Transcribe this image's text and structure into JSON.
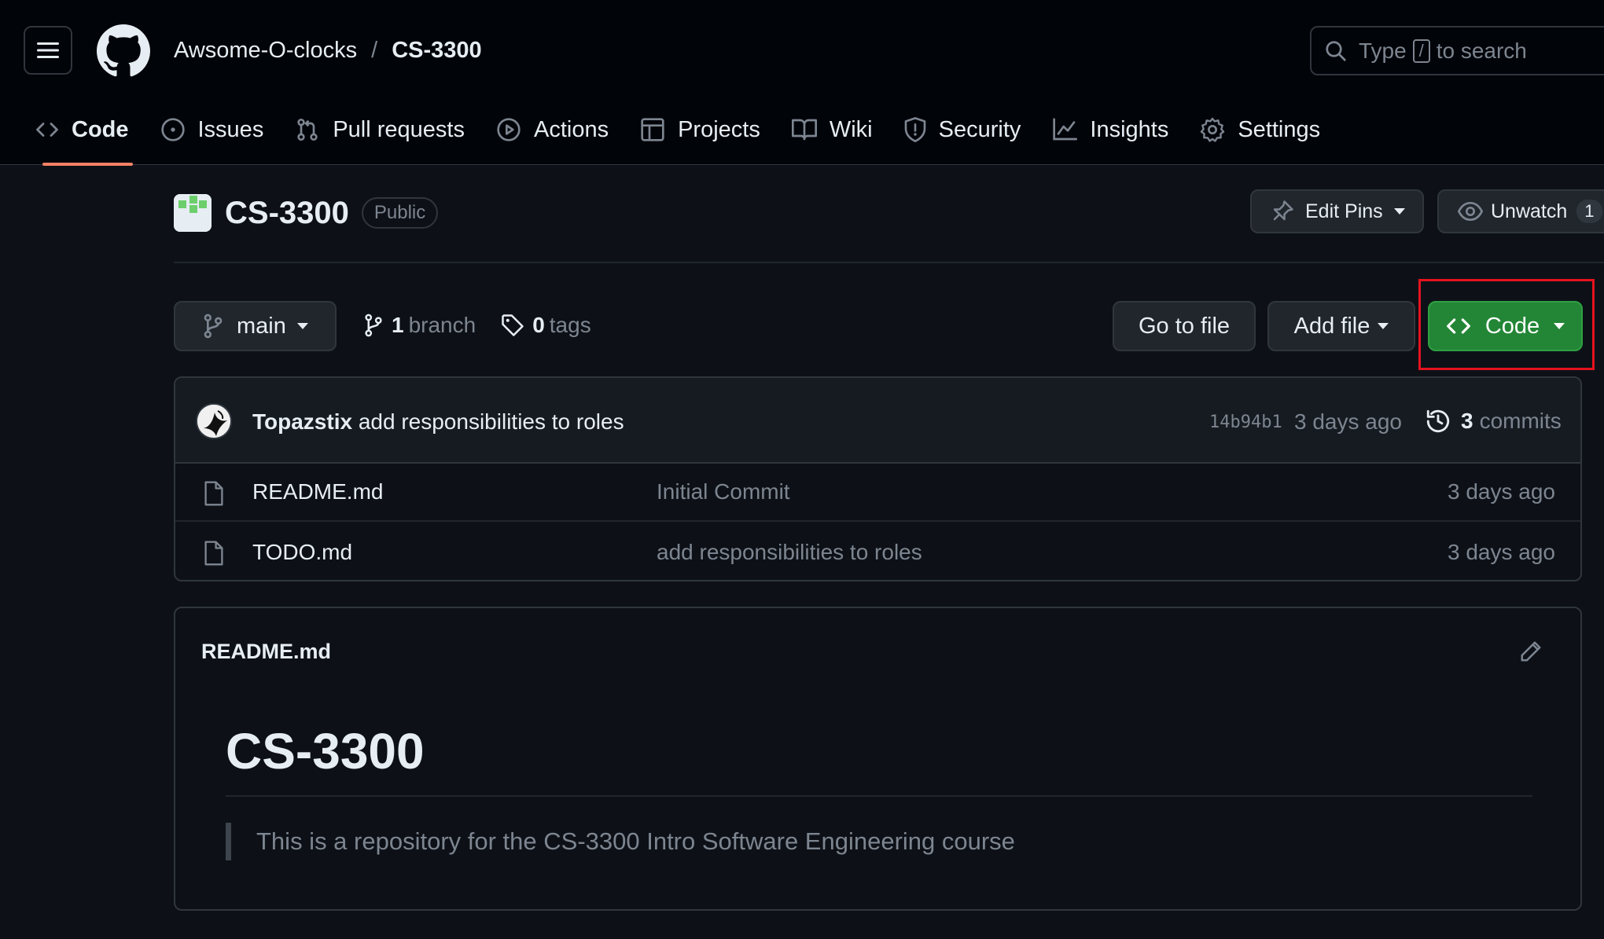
{
  "header": {
    "owner": "Awsome-O-clocks",
    "separator": "/",
    "repo": "CS-3300",
    "search": {
      "prefix": "Type",
      "key": "/",
      "suffix": "to search"
    }
  },
  "tabs": [
    {
      "label": "Code",
      "icon": "code-icon",
      "active": true
    },
    {
      "label": "Issues",
      "icon": "issue-icon"
    },
    {
      "label": "Pull requests",
      "icon": "pull-request-icon"
    },
    {
      "label": "Actions",
      "icon": "play-icon"
    },
    {
      "label": "Projects",
      "icon": "table-icon"
    },
    {
      "label": "Wiki",
      "icon": "book-icon"
    },
    {
      "label": "Security",
      "icon": "shield-icon"
    },
    {
      "label": "Insights",
      "icon": "graph-icon"
    },
    {
      "label": "Settings",
      "icon": "gear-icon"
    }
  ],
  "repo": {
    "name": "CS-3300",
    "visibility": "Public",
    "edit_pins_label": "Edit Pins",
    "unwatch_label": "Unwatch",
    "watch_count": "1"
  },
  "toolbar": {
    "branch": "main",
    "branch_count": "1",
    "branch_word": "branch",
    "tag_count": "0",
    "tag_word": "tags",
    "goto_file": "Go to file",
    "add_file": "Add file",
    "code": "Code"
  },
  "latest_commit": {
    "author": "Topazstix",
    "message": "add responsibilities to roles",
    "sha": "14b94b1",
    "date": "3 days ago",
    "commit_count": "3",
    "commit_word": "commits"
  },
  "files": [
    {
      "name": "README.md",
      "message": "Initial Commit",
      "date": "3 days ago"
    },
    {
      "name": "TODO.md",
      "message": "add responsibilities to roles",
      "date": "3 days ago"
    }
  ],
  "readme": {
    "filename": "README.md",
    "heading": "CS-3300",
    "quote": "This is a repository for the CS-3300 Intro Software Engineering course"
  },
  "colors": {
    "background": "#0d1117",
    "header_bg": "#010409",
    "code_button": "#238636",
    "active_tab_underline": "#f78166",
    "highlight_box": "#e5121f"
  }
}
